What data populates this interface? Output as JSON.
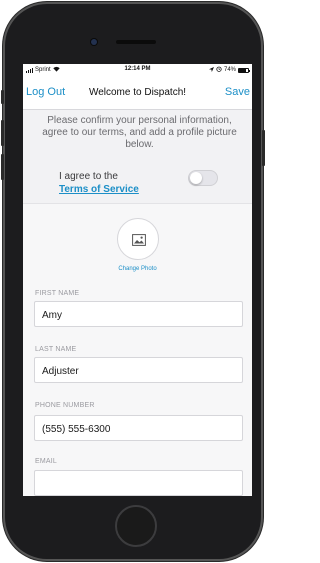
{
  "status_bar": {
    "carrier": "Sprint",
    "time": "12:14 PM",
    "battery_percent": "74%",
    "battery_level": 0.74
  },
  "nav": {
    "left_label": "Log Out",
    "title": "Welcome to Dispatch!",
    "right_label": "Save"
  },
  "intro": {
    "text": "Please confirm your personal information, agree to our terms, and add a profile picture below."
  },
  "terms": {
    "prefix": "I agree to the",
    "link": "Terms of Service",
    "toggle_on": false
  },
  "photo": {
    "label": "Change Photo"
  },
  "fields": [
    {
      "label": "FIRST NAME",
      "value": "Amy"
    },
    {
      "label": "LAST NAME",
      "value": "Adjuster"
    },
    {
      "label": "PHONE NUMBER",
      "value": "(555) 555-6300"
    },
    {
      "label": "EMAIL",
      "value": ""
    }
  ],
  "icons": {
    "signal": "signal-bars-icon",
    "wifi": "wifi-icon",
    "location": "location-arrow-icon",
    "battery": "battery-icon",
    "photo": "image-icon"
  },
  "colors": {
    "accent": "#1c8fc7",
    "muted_text": "#6b6b6f",
    "label_text": "#9a9aa0"
  }
}
